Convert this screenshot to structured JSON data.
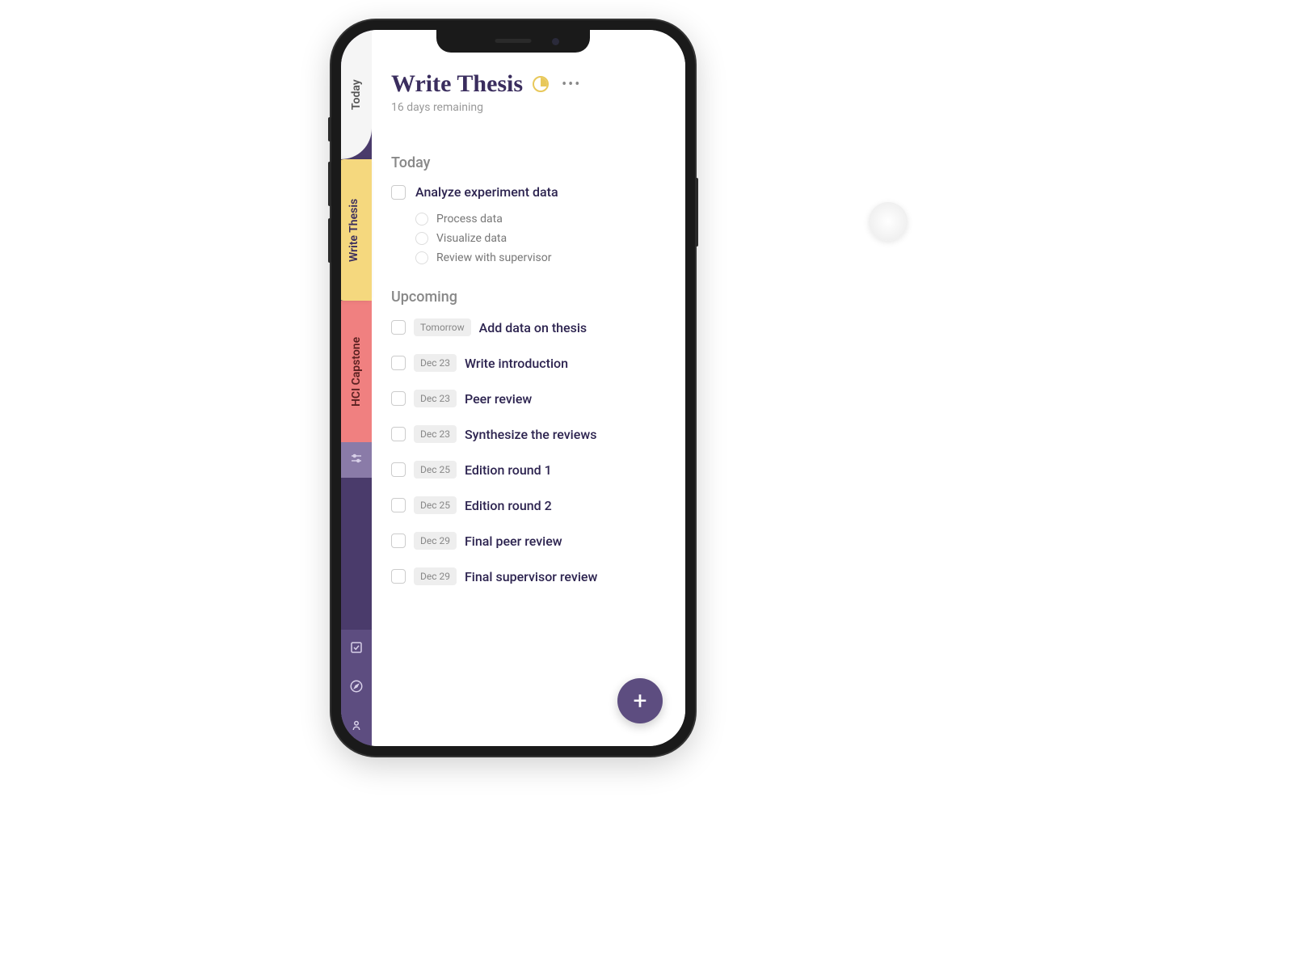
{
  "sidebar": {
    "tabs": [
      {
        "label": "Today"
      },
      {
        "label": "Write Thesis"
      },
      {
        "label": "HCI Capstone"
      }
    ]
  },
  "header": {
    "title": "Write Thesis",
    "subtitle": "16 days remaining"
  },
  "sections": {
    "today": {
      "title": "Today",
      "task": {
        "text": "Analyze experiment data",
        "subtasks": [
          {
            "text": "Process data"
          },
          {
            "text": "Visualize data"
          },
          {
            "text": "Review with supervisor"
          }
        ]
      }
    },
    "upcoming": {
      "title": "Upcoming",
      "tasks": [
        {
          "date": "Tomorrow",
          "text": "Add data on thesis"
        },
        {
          "date": "Dec 23",
          "text": "Write introduction"
        },
        {
          "date": "Dec 23",
          "text": "Peer review"
        },
        {
          "date": "Dec 23",
          "text": "Synthesize the reviews"
        },
        {
          "date": "Dec 25",
          "text": "Edition round 1"
        },
        {
          "date": "Dec 25",
          "text": "Edition round 2"
        },
        {
          "date": "Dec 29",
          "text": "Final peer review"
        },
        {
          "date": "Dec 29",
          "text": "Final supervisor review"
        }
      ]
    }
  },
  "fab": {
    "label": "+"
  }
}
